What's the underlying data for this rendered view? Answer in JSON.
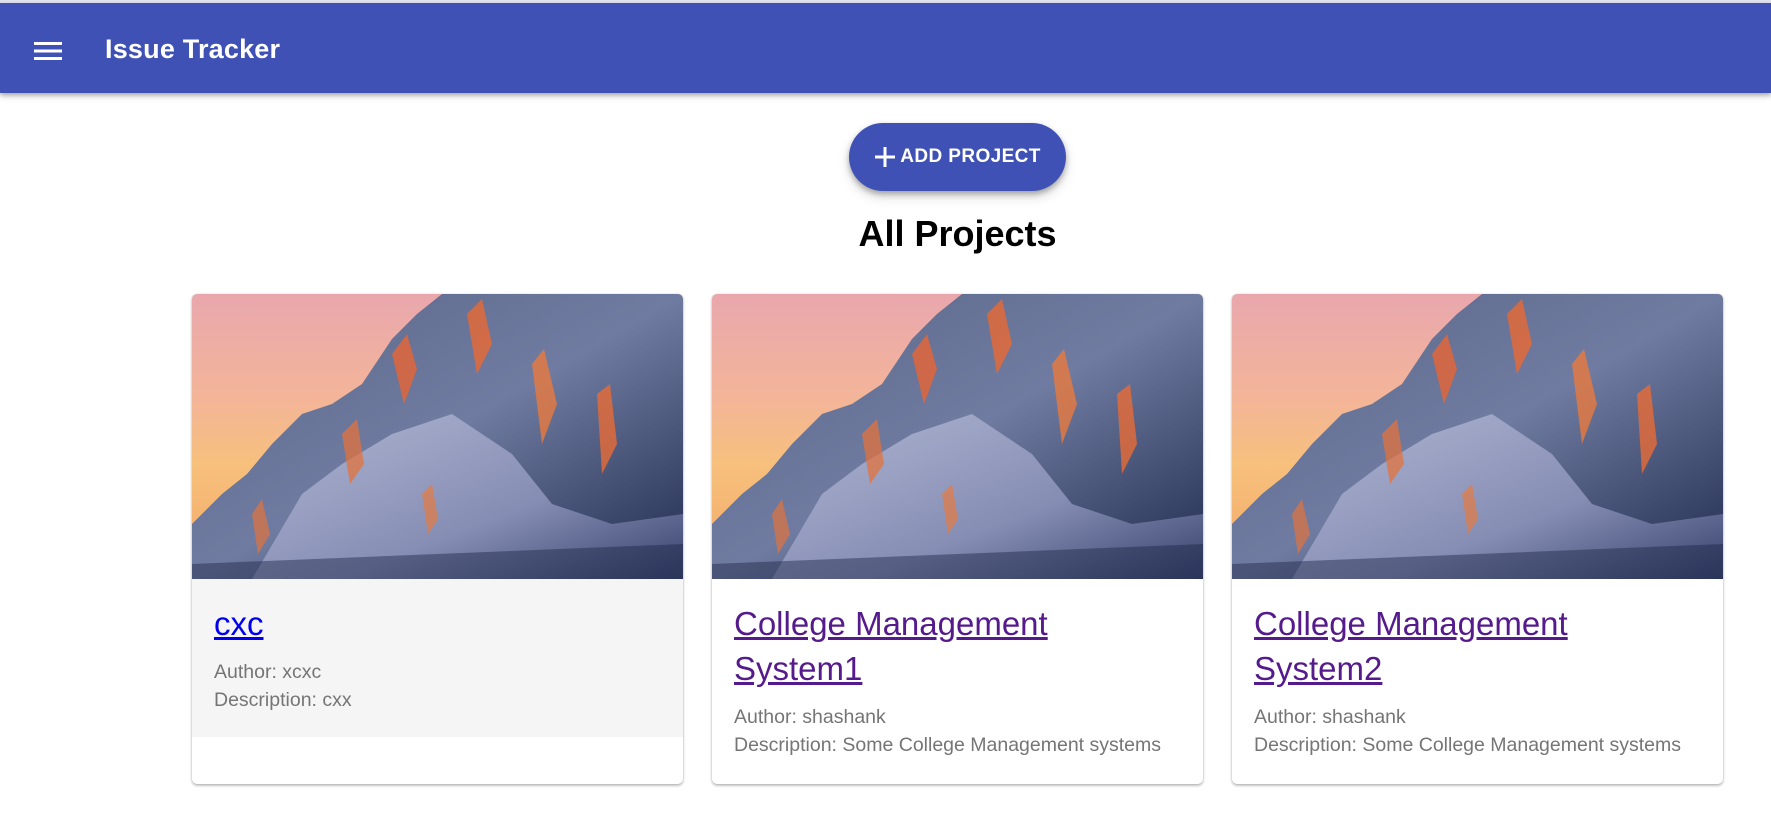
{
  "header": {
    "title": "Issue Tracker",
    "menu_icon": "hamburger-menu-icon",
    "background": "#3f51b5"
  },
  "toolbar": {
    "add_label": "ADD PROJECT",
    "add_icon": "plus-icon"
  },
  "main": {
    "heading": "All Projects"
  },
  "projects": [
    {
      "title": "cxc",
      "author": "Author: xcxc",
      "description": "Description: cxx",
      "image": "snowy-mountain-sunset"
    },
    {
      "title": "College Management System1",
      "author": "Author: shashank",
      "description": "Description: Some College Management systems",
      "image": "snowy-mountain-sunset"
    },
    {
      "title": "College Management System2",
      "author": "Author: shashank",
      "description": "Description: Some College Management systems",
      "image": "snowy-mountain-sunset"
    }
  ],
  "colors": {
    "primary": "#3f51b5",
    "link": "#0000ee",
    "visited_link": "#551a8b",
    "muted_text": "#757575"
  }
}
